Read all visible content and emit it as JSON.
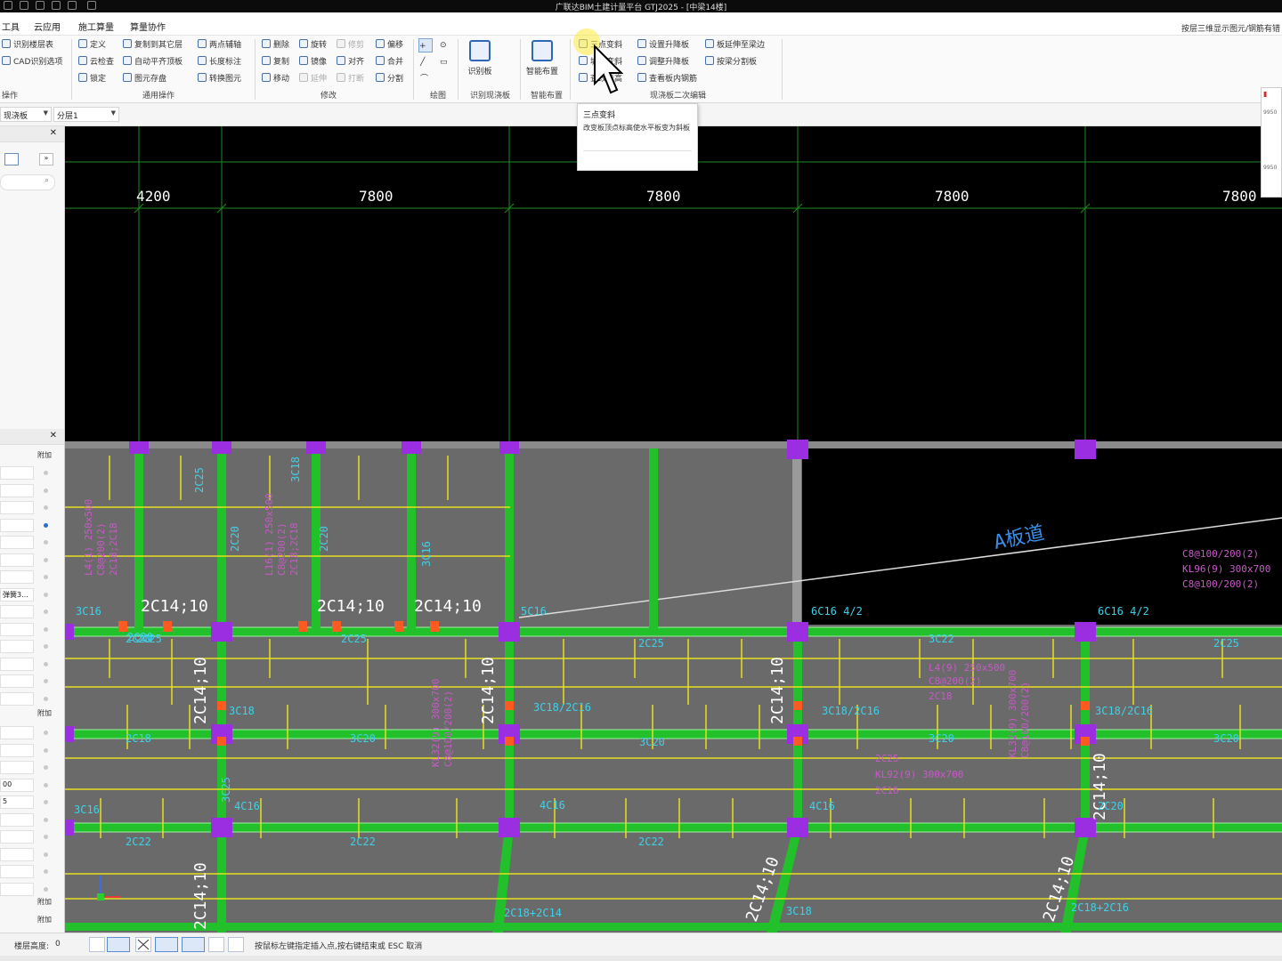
{
  "window": {
    "title": "广联达BIM土建计量平台 GTJ2025 - [中梁14楼]"
  },
  "menu": {
    "items": [
      "工具",
      "云应用",
      "施工算量",
      "算量协作"
    ],
    "right_note": "按层三维显示图元/钢筋有错"
  },
  "ribbon": {
    "col1": [
      "识别楼层表",
      "CAD识别选项"
    ],
    "col2": [
      "定义",
      "云检查",
      "锁定"
    ],
    "col3": [
      "复制到其它层",
      "自动平齐顶板",
      "图元存盘"
    ],
    "col4": [
      "两点辅轴",
      "长度标注",
      "转换图元"
    ],
    "col5": [
      "删除",
      "复制",
      "移动"
    ],
    "col6": [
      "旋转",
      "镜像",
      "延伸"
    ],
    "col7": [
      "修剪",
      "对齐",
      "打断"
    ],
    "col8": [
      "偏移",
      "合并",
      "分割"
    ],
    "groups": [
      "操作",
      "通用操作",
      "修改",
      "绘图",
      "识别现浇板",
      "智能布置",
      "现浇板二次编辑"
    ],
    "big_shibie": "识别板",
    "big_zhineng": "智能布置",
    "col9": [
      "三点变斜",
      "坡度变斜",
      "查改标高"
    ],
    "col10": [
      "设置升降板",
      "调整升降板",
      "查看板内钢筋"
    ],
    "col11": [
      "板延伸至梁边",
      "按梁分割板"
    ]
  },
  "tooltip": {
    "title": "三点变斜",
    "body": "改变板顶点标高使水平板变为斜板"
  },
  "toolbar2": {
    "category": "现浇板",
    "layer": "分层1"
  },
  "leftpanel": {
    "fujia": "附加",
    "row_value1": "弹簧3...",
    "row_value2": "00",
    "row_value3": "5"
  },
  "minipanel": {
    "v1": "9950",
    "v2": "9950"
  },
  "status": {
    "height_label": "楼层高度:",
    "height_value": "0",
    "hint": "按鼠标左键指定插入点,按右键结束或 ESC 取消"
  },
  "cad": {
    "dims": [
      "4200",
      "7800",
      "7800",
      "7800",
      "7800"
    ],
    "annotation_ramp": "A板道",
    "colors": {
      "beam": "#22c02a",
      "axis": "#1f8a1f",
      "rebar": "#e8e020",
      "text_cyan": "#3fd1e8",
      "text_pink": "#c85ac8",
      "column": "#9b2ee0",
      "slab": "#6a6a6a"
    },
    "white_labels": [
      "2C14;10",
      "2C14;10",
      "2C14;10",
      "2C14;10",
      "2C14;10",
      "2C14;10",
      "2C14;10",
      "2C14;10",
      "2C14;10",
      "2C14;10"
    ],
    "cyan_labels": [
      "2C25",
      "2C20",
      "3C18",
      "2C20",
      "3C16",
      "2C20",
      "2C25",
      "2C25",
      "2C20",
      "3C16",
      "5C16",
      "6C16 4/2",
      "6C16 4/2",
      "2C25",
      "3C22",
      "2C25",
      "3C18",
      "3C18/2C16",
      "3C18/2C16",
      "3C18/2C16",
      "2C18",
      "3C20",
      "3C20",
      "3C20",
      "3C20",
      "3C25",
      "3C16",
      "4C16",
      "4C16",
      "4C16",
      "2C20",
      "2C22",
      "2C22",
      "2C22",
      "2C18+2C14",
      "3C18",
      "2C18+2C16"
    ],
    "pink_labels": [
      "L4(1) 250x500",
      "C8@200(2)",
      "2C18;2C18",
      "L16(1) 250x500",
      "C8@200(2)",
      "2C18;2C18",
      "L4(9) 250x500",
      "C8@200(2)",
      "2C18",
      "KL32(9) 300x700",
      "C8@100/200(2)",
      "KL32(9) 300x700",
      "C8@100/200(2)",
      "2C25",
      "KL92(9) 300x700",
      "C8@100/200(2)",
      "KL96(9) 300x700",
      "C8@100/200(2)",
      "2C16"
    ]
  }
}
